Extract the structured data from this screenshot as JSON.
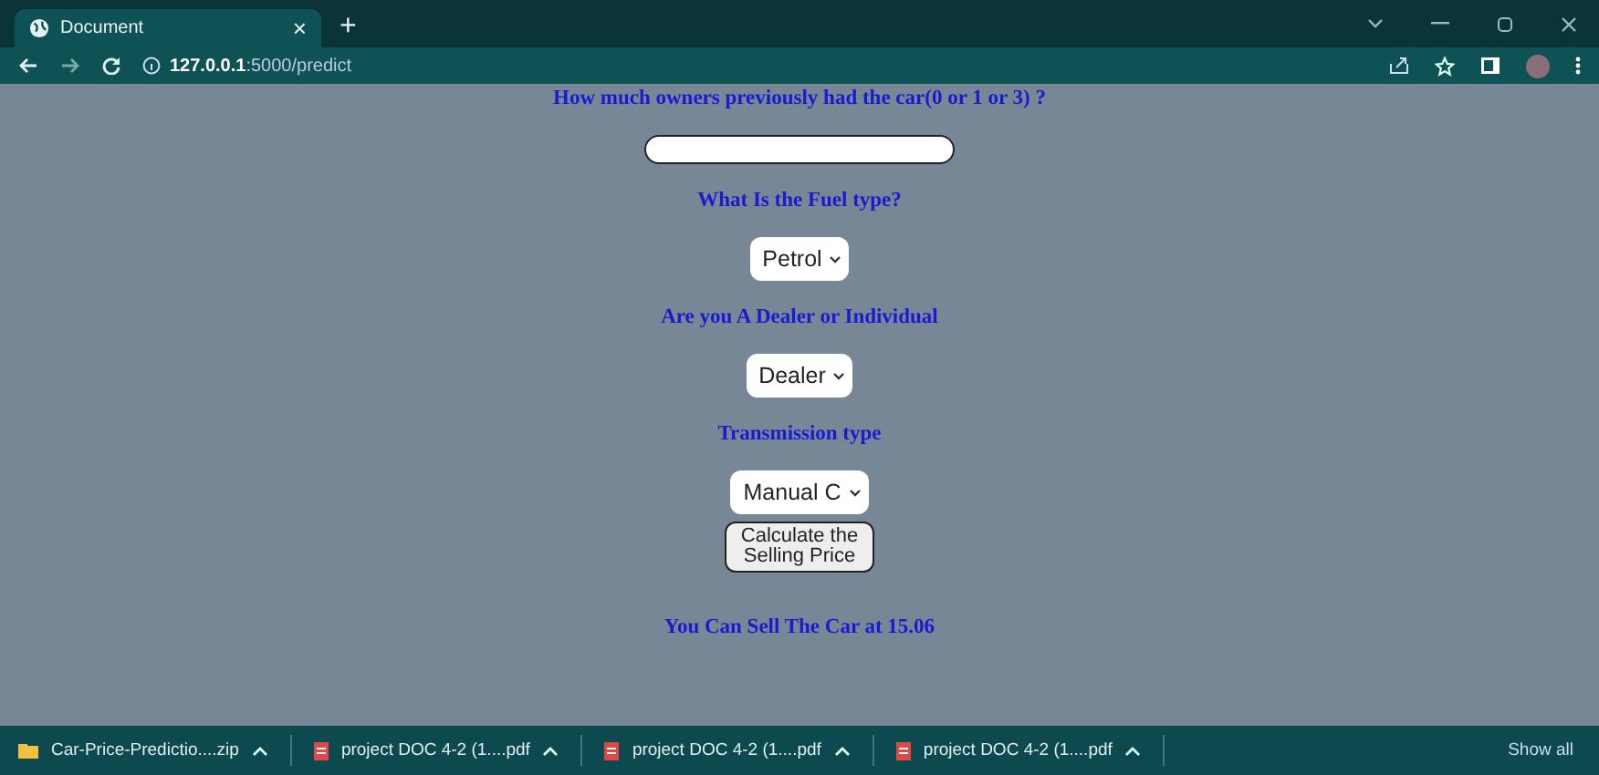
{
  "browser": {
    "tab_title": "Document",
    "tab_close": "×",
    "new_tab": "+",
    "url_host": "127.0.0.1",
    "url_path": ":5000/predict"
  },
  "form": {
    "questions": [
      {
        "kind": "text",
        "label": "How much owners previously had the car(0 or 1 or 3) ?"
      },
      {
        "kind": "select",
        "label": "What Is the Fuel type?",
        "value": "Petrol"
      },
      {
        "kind": "select",
        "label": "Are you A Dealer or Individual",
        "value": "Dealer"
      },
      {
        "kind": "select",
        "label": "Transmission type",
        "value": "Manual C"
      }
    ],
    "button": "Calculate the Selling Price",
    "result": "You Can Sell The Car at 15.06"
  },
  "downloads": {
    "items": [
      {
        "kind": "folder",
        "name": "Car-Price-Predictio....zip"
      },
      {
        "kind": "pdf",
        "name": "project DOC 4-2 (1....pdf"
      },
      {
        "kind": "pdf",
        "name": "project DOC 4-2 (1....pdf"
      },
      {
        "kind": "pdf",
        "name": "project DOC 4-2 (1....pdf"
      }
    ],
    "show_all": "Show all"
  }
}
